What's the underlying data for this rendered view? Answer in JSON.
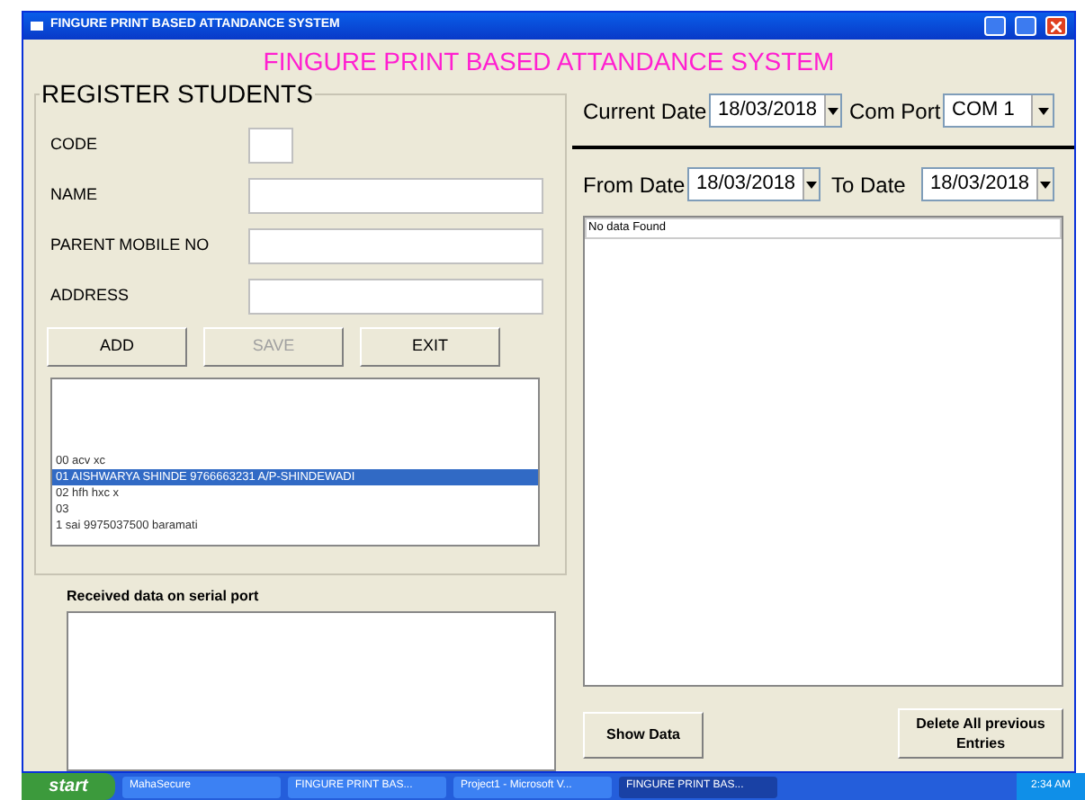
{
  "window": {
    "title": "FINGURE PRINT BASED ATTANDANCE SYSTEM"
  },
  "heading": "FINGURE PRINT BASED ATTANDANCE SYSTEM",
  "register": {
    "title": "REGISTER STUDENTS",
    "fields": [
      {
        "label": "CODE",
        "kind": "short"
      },
      {
        "label": "NAME",
        "kind": "long"
      },
      {
        "label": "PARENT MOBILE NO",
        "kind": "long"
      },
      {
        "label": "ADDRESS",
        "kind": "long"
      }
    ],
    "buttons": [
      {
        "label": "ADD",
        "disabled": false
      },
      {
        "label": "SAVE",
        "disabled": true
      },
      {
        "label": "EXIT",
        "disabled": false
      }
    ],
    "students": [
      {
        "text": "00  acv  xc",
        "selected": false
      },
      {
        "text": "01  AISHWARYA SHINDE  9766663231  A/P-SHINDEWADI",
        "selected": true
      },
      {
        "text": "02  hfh  hxc  x",
        "selected": false
      },
      {
        "text": "03",
        "selected": false
      },
      {
        "text": "1  sai  9975037500  baramati",
        "selected": false
      }
    ]
  },
  "serial": {
    "label": "Received data on serial port"
  },
  "current_date": {
    "label": "Current Date",
    "value": "18/03/2018"
  },
  "com_port": {
    "label": "Com Port",
    "value": "COM 1"
  },
  "from_date": {
    "label": "From Date",
    "value": "18/03/2018"
  },
  "to_date": {
    "label": "To Date",
    "value": "18/03/2018"
  },
  "report": {
    "header": "No data  Found"
  },
  "show_button": "Show Data",
  "delete_button": "Delete All previous Entries",
  "taskbar": {
    "start": "start",
    "items": [
      {
        "label": "MahaSecure",
        "selected": false
      },
      {
        "label": "FINGURE PRINT BAS...",
        "selected": false
      },
      {
        "label": "Project1 - Microsoft V...",
        "selected": false
      },
      {
        "label": "FINGURE PRINT BAS...",
        "selected": true
      }
    ],
    "clock": "2:34 AM"
  }
}
